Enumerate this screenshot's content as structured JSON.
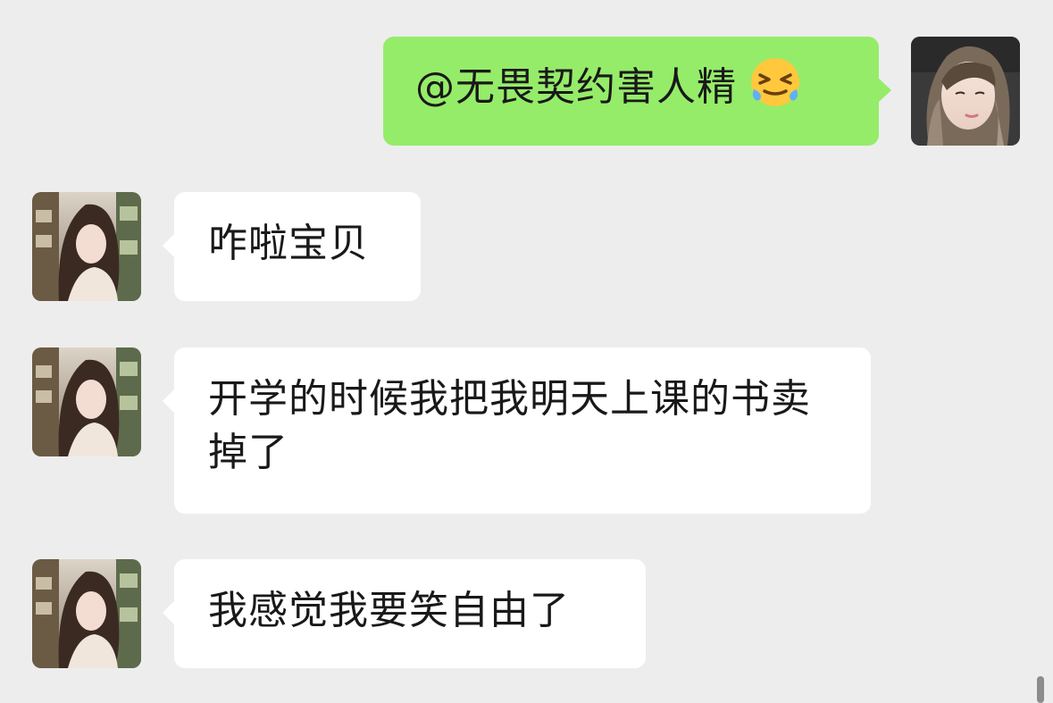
{
  "colors": {
    "background": "#ededed",
    "outgoing_bubble": "#95ec69",
    "incoming_bubble": "#ffffff",
    "text": "#191919"
  },
  "messages": [
    {
      "direction": "outgoing",
      "text": "@无畏契约害人精",
      "emoji": "crying-laughing-face-icon"
    },
    {
      "direction": "incoming",
      "text": "咋啦宝贝"
    },
    {
      "direction": "incoming",
      "text": "开学的时候我把我明天上课的书卖掉了"
    },
    {
      "direction": "incoming",
      "text": "我感觉我要笑自由了"
    }
  ]
}
